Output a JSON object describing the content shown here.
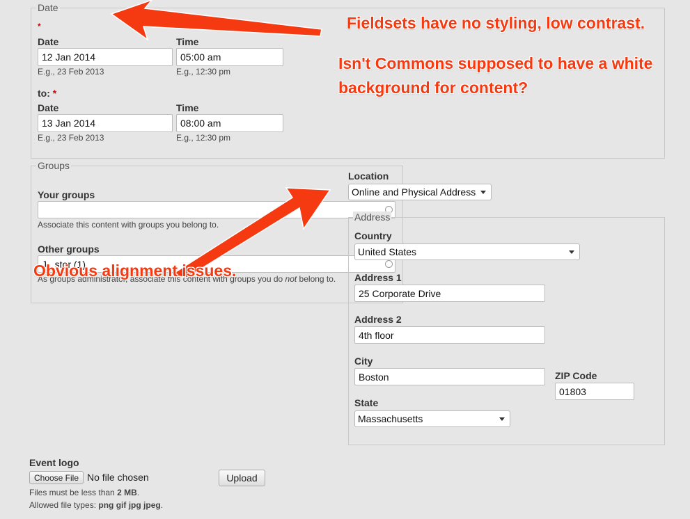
{
  "date_fieldset": {
    "legend": "Date",
    "required_mark": "*",
    "from": {
      "date_label": "Date",
      "date_value": "12 Jan 2014",
      "date_hint": "E.g., 23 Feb 2013",
      "time_label": "Time",
      "time_value": "05:00 am",
      "time_hint": "E.g., 12:30 pm"
    },
    "to_label": "to:",
    "to": {
      "date_label": "Date",
      "date_value": "13 Jan 2014",
      "date_hint": "E.g., 23 Feb 2013",
      "time_label": "Time",
      "time_value": "08:00 am",
      "time_hint": "E.g., 12:30 pm"
    }
  },
  "groups_fieldset": {
    "legend": "Groups",
    "your_groups_label": "Your groups",
    "your_groups_value": "",
    "your_groups_desc": "Associate this content with groups you belong to.",
    "other_groups_label": "Other groups",
    "other_groups_value": "J   stor (1)",
    "other_groups_desc_pre": "As groups administrator, associate this content with groups you do ",
    "other_groups_desc_em": "not",
    "other_groups_desc_post": " belong to."
  },
  "location": {
    "label": "Location",
    "selected": "Online and Physical Address",
    "address_legend": "Address",
    "country_label": "Country",
    "country_selected": "United States",
    "address1_label": "Address 1",
    "address1_value": "25 Corporate Drive",
    "address2_label": "Address 2",
    "address2_value": "4th floor",
    "city_label": "City",
    "city_value": "Boston",
    "zip_label": "ZIP Code",
    "zip_value": "01803",
    "state_label": "State",
    "state_selected": "Massachusetts"
  },
  "event_logo": {
    "label": "Event logo",
    "choose_file_label": "Choose File",
    "no_file_text": "No file chosen",
    "upload_label": "Upload",
    "size_pre": "Files must be less than ",
    "size_value": "2 MB",
    "size_post": ".",
    "types_pre": "Allowed file types: ",
    "types_value": "png gif jpg jpeg",
    "types_post": "."
  },
  "annotations": {
    "fieldsets": "Fieldsets have no styling, low contrast.",
    "background_line1": "Isn't Commons supposed to have a white",
    "background_line2": "background for content?",
    "alignment": "Obvious alignment issues."
  },
  "colors": {
    "annotation": "#f53a12",
    "page_background": "#e6e6e6"
  }
}
